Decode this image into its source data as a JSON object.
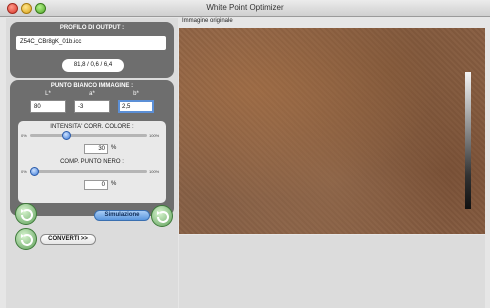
{
  "window": {
    "title": "White Point Optimizer"
  },
  "output_profile": {
    "title": "PROFILO DI OUTPUT :",
    "filename": "Z54C_CBr8gK_01b.icc",
    "lab_values": "81,8 / 0,6 / 6,4"
  },
  "white_point": {
    "title": "PUNTO BIANCO IMMAGINE :",
    "columns": [
      "L*",
      "a*",
      "b*"
    ],
    "values": [
      "80",
      "-3",
      "2,5"
    ]
  },
  "color_correction": {
    "title": "INTENSITA' CORR. COLORE :",
    "min_label": "0%",
    "max_label": "100%",
    "value": "30",
    "percent": 30,
    "pct_sign": "%"
  },
  "black_point": {
    "title": "COMP. PUNTO NERO :",
    "min_label": "0%",
    "max_label": "100%",
    "value": "0",
    "percent": 0,
    "pct_sign": "%"
  },
  "buttons": {
    "simulation": "Simulazione",
    "convert": "CONVERTI >>"
  },
  "image": {
    "label": "Immagine originale"
  },
  "icons": {
    "refresh_top": "refresh-icon",
    "refresh_bottom": "refresh-icon",
    "simulation_refresh": "refresh-icon"
  }
}
